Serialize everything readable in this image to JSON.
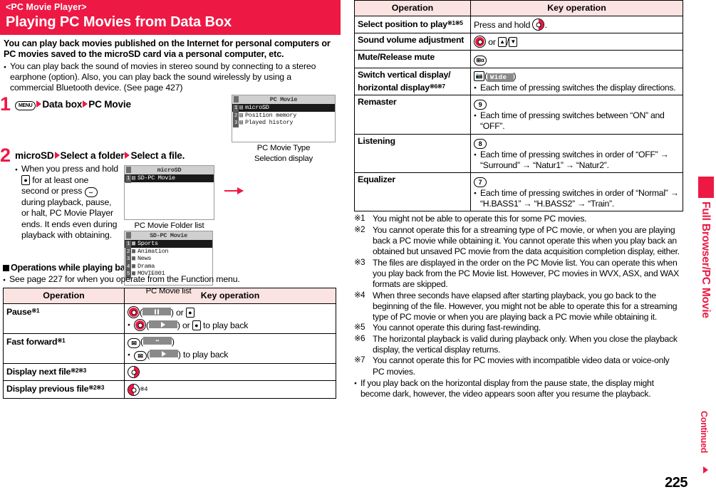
{
  "banner": {
    "kicker": "<PC Movie Player>",
    "title": "Playing PC Movies from Data Box",
    "color": "#ED1944"
  },
  "intro": {
    "lead": "You can play back movies published on the Internet for personal computers or PC movies saved to the microSD card via a personal computer, etc.",
    "note": "You can play back the sound of movies in stereo sound by connecting to a stereo earphone (option). Also, you can play back the sound wirelessly by using a commercial Bluetooth device. (See page 427)"
  },
  "steps": [
    {
      "num": "1",
      "key_label": "MENU",
      "parts": [
        "Data box",
        "PC Movie"
      ],
      "screen": {
        "title": "PC Movie",
        "rows": [
          {
            "num": "1",
            "label": "microSD",
            "selected": true
          },
          {
            "num": "2",
            "label": "Position memory",
            "selected": false
          },
          {
            "num": "3",
            "label": "Played history",
            "selected": false
          }
        ],
        "caption_line1": "PC Movie Type",
        "caption_line2": "Selection display"
      }
    },
    {
      "num": "2",
      "head_parts": [
        "microSD",
        "Select a folder",
        "Select a file."
      ],
      "body": "When you press and hold   for at least one second or press   during playback, pause, or halt, PC Movie Player ends. It ends even during playback with obtaining.",
      "screens": [
        {
          "title": "microSD",
          "rows": [
            {
              "num": "1",
              "label": "SD-PC Movie",
              "selected": true
            }
          ],
          "caption": "PC Movie Folder list"
        },
        {
          "title": "SD-PC Movie",
          "rows": [
            {
              "num": "1",
              "label": "Sports",
              "selected": true
            },
            {
              "num": "2",
              "label": "Animation",
              "selected": false
            },
            {
              "num": "3",
              "label": "News",
              "selected": false
            },
            {
              "num": "4",
              "label": "Drama",
              "selected": false
            },
            {
              "num": "5",
              "label": "MOVIE001",
              "selected": false
            }
          ],
          "caption": "PC Movie list"
        }
      ]
    }
  ],
  "section": {
    "heading": "Operations while playing back a PC movie",
    "note": "See page 227 for when you operate from the Function menu."
  },
  "table_left": {
    "headers": [
      "Operation",
      "Key operation"
    ],
    "rows": [
      {
        "operation": "Pause",
        "marks": "※1",
        "lines": [
          {
            "bullet": false,
            "text": ") or ",
            "prefix_key": "center",
            "softkey": "pause",
            "suffix": " or ",
            "tail_key": "camera",
            "tail_text": ""
          },
          {
            "bullet": true,
            "prefix_key": "center",
            "softkey": "play",
            "suffix": " or ",
            "tail_key": "camera",
            "tail_text": " to play back"
          }
        ]
      },
      {
        "operation": "Fast forward",
        "marks": "※1",
        "lines": [
          {
            "bullet": false,
            "prefix_key": "mail",
            "softkey": "ff",
            "suffix": "",
            "tail_key": null,
            "tail_text": ""
          },
          {
            "bullet": true,
            "prefix_key": "mail",
            "softkey": "play",
            "suffix": "",
            "tail_key": null,
            "tail_text": " to play back"
          }
        ]
      },
      {
        "operation": "Display next file",
        "marks": "※2※3",
        "lines": [
          {
            "bullet": false,
            "nav": "right",
            "tail_text": ""
          }
        ]
      },
      {
        "operation": "Display previous file",
        "marks": "※2※3",
        "lines": [
          {
            "bullet": false,
            "nav": "left",
            "tail_text": "",
            "sup": "※4"
          }
        ]
      }
    ]
  },
  "table_right": {
    "headers": [
      "Operation",
      "Key operation"
    ],
    "rows": [
      {
        "operation": "Select position to play",
        "marks": "※1※5",
        "key_text_before": "Press and hold ",
        "key_icon": "nav-right",
        "key_text_after": ".",
        "notes": []
      },
      {
        "operation": "Sound volume adjustment",
        "marks": "",
        "key_icon": "nav-vertical",
        "key_text_after": " or ",
        "extra_keys": [
          "up",
          "down"
        ],
        "notes": []
      },
      {
        "operation": "Mute/Release mute",
        "marks": "",
        "key_icon": "i-alpha",
        "notes": []
      },
      {
        "operation": "Switch vertical display/ horizontal display",
        "operation_line1": "Switch vertical display/",
        "operation_line2": "horizontal display",
        "marks": "※6※7",
        "key_icon": "camera",
        "softkey_label": "Wide",
        "notes": [
          "Each time of pressing switches the display directions."
        ]
      },
      {
        "operation": "Remaster",
        "marks": "",
        "key_icon": "num-9",
        "notes": [
          "Each time of pressing switches between “ON” and “OFF”."
        ]
      },
      {
        "operation": "Listening",
        "marks": "",
        "key_icon": "num-8",
        "notes": [
          "Each time of pressing switches in order of “OFF” → “Surround” → “Natur1” → “Natur2”."
        ]
      },
      {
        "operation": "Equalizer",
        "marks": "",
        "key_icon": "num-7",
        "notes": [
          "Each time of pressing switches in order of “Normal” → “H.BASS1” → “H.BASS2” → “Train”."
        ]
      }
    ]
  },
  "footnotes": [
    {
      "mark": "※1",
      "text": "You might not be able to operate this for some PC movies."
    },
    {
      "mark": "※2",
      "text": "You cannot operate this for a streaming type of PC movie, or when you are playing back a PC movie while obtaining it. You cannot operate this when you play back an obtained but unsaved PC movie from the data acquisition completion display, either."
    },
    {
      "mark": "※3",
      "text": "The files are displayed in the order on the PC Movie list. You can operate this when you play back from the PC Movie list. However, PC movies in WVX, ASX, and WAX formats are skipped."
    },
    {
      "mark": "※4",
      "text": "When three seconds have elapsed after starting playback, you go back to the beginning of the file. However, you might not be able to operate this for a streaming type of PC movie or when you are playing back a PC movie while obtaining it."
    },
    {
      "mark": "※5",
      "text": "You cannot operate this during fast-rewinding."
    },
    {
      "mark": "※6",
      "text": "The horizontal playback is valid during playback only. When you close the playback display, the vertical display returns."
    },
    {
      "mark": "※7",
      "text": "You cannot operate this for PC movies with incompatible video data or voice-only PC movies."
    }
  ],
  "final_bullet": "If you play back on the horizontal display from the pause state, the display might become dark, however, the video appears soon after you resume the playback.",
  "sidebar": {
    "tab_label": "Full Browser/PC Movie",
    "continued": "Continued",
    "page_number": "225"
  }
}
